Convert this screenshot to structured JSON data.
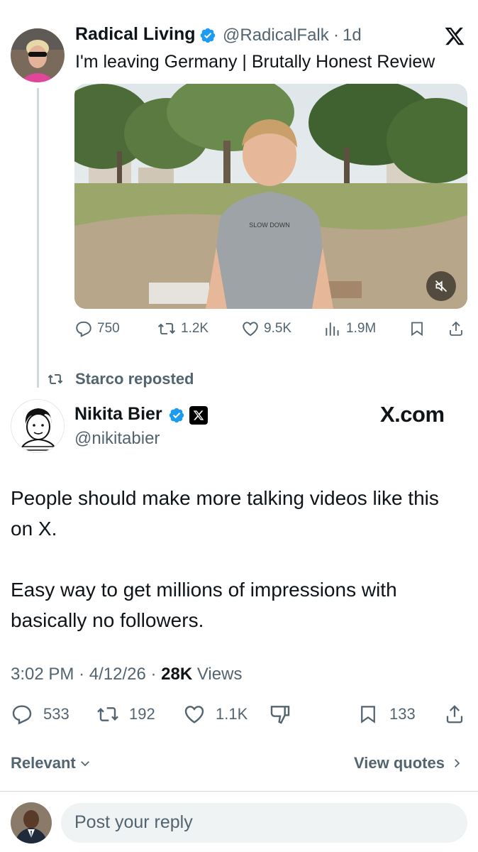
{
  "parent_tweet": {
    "author_name": "Radical Living",
    "handle": "@RadicalFalk",
    "separator": "·",
    "time": "1d",
    "text": "I'm leaving Germany | Brutally Honest Review",
    "video_shirt_text": "SLOW DOWN",
    "actions": {
      "replies": "750",
      "reposts": "1.2K",
      "likes": "9.5K",
      "views": "1.9M"
    }
  },
  "repost_label": "Starco reposted",
  "main_tweet": {
    "author_name": "Nikita Bier",
    "handle": "@nikitabier",
    "affiliation": "X.com",
    "text_line1": "People should make more talking videos like this",
    "text_line2": "on X.",
    "text_line3": "Easy way to get millions of impressions with",
    "text_line4": "basically no followers.",
    "meta": {
      "time": "3:02 PM",
      "sep1": "·",
      "date": "4/12/26",
      "sep2": "·",
      "views_count": "28K",
      "views_label": "Views"
    },
    "actions": {
      "replies": "533",
      "reposts": "192",
      "likes": "1.1K",
      "bookmarks": "133"
    }
  },
  "sort_label": "Relevant",
  "view_quotes_label": "View quotes",
  "reply_placeholder": "Post your reply",
  "colors": {
    "verified_blue": "#1d9bf0",
    "secondary_text": "#536471",
    "primary_text": "#0f1419"
  }
}
